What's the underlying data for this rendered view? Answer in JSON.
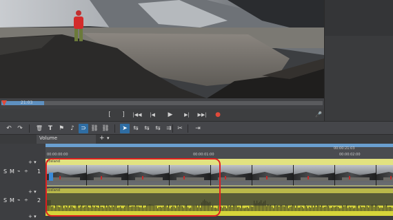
{
  "preview": {
    "timecode": "21:03"
  },
  "transport": {
    "buttons": [
      "[",
      "]",
      "|◀◀",
      "|◀",
      "▶",
      "▶|",
      "▶▶|",
      "●"
    ]
  },
  "toolbar": {
    "items": [
      "↶",
      "↷",
      "🗑",
      "T",
      "⚑",
      "♪",
      "∞",
      "⊃",
      "⛓",
      "⛓",
      "➤",
      "⇆",
      "⇆",
      "⇆",
      "⇉",
      "✂",
      "⇥"
    ]
  },
  "timeline": {
    "tab_label": "Volume",
    "ruler": {
      "t0": "00:00:00:00",
      "t1": "00:00:01:00",
      "t2": "00:00:21:03",
      "t3": "00:00:02:00"
    },
    "tracks": [
      {
        "number": "1",
        "solo": "S",
        "mute": "M",
        "clip_label": "Iceland"
      },
      {
        "number": "2",
        "solo": "S",
        "mute": "M",
        "clip_label": "Iceland"
      }
    ]
  },
  "colors": {
    "accent_blue": "#2f6da3",
    "video_clip": "#e2e280",
    "audio_clip": "#d5d43a",
    "highlight": "#e02020",
    "record": "#e04a3a"
  }
}
